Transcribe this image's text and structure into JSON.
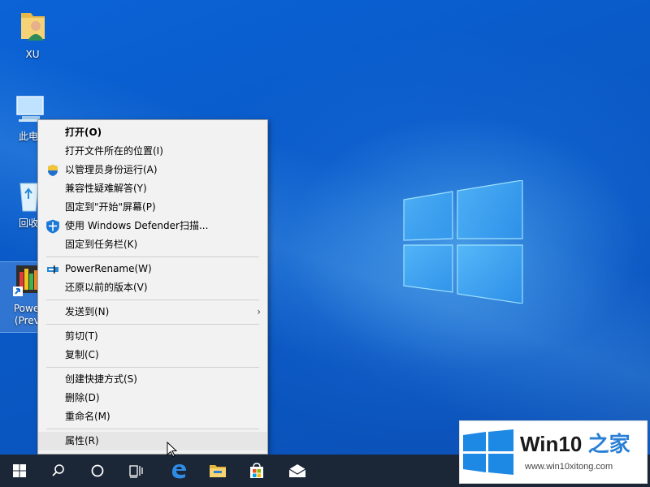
{
  "desktop": {
    "icons": [
      {
        "label": "XU",
        "icon": "user-folder-icon"
      },
      {
        "label": "此电",
        "icon": "this-pc-icon"
      },
      {
        "label": "回收",
        "icon": "recycle-bin-icon"
      },
      {
        "label": "Power",
        "label2": "(Previ",
        "icon": "powertoys-shortcut-icon"
      }
    ]
  },
  "context_menu": {
    "items": [
      {
        "label": "打开(O)",
        "bold": true
      },
      {
        "label": "打开文件所在的位置(I)"
      },
      {
        "label": "以管理员身份运行(A)",
        "icon": "uac-shield-icon"
      },
      {
        "label": "兼容性疑难解答(Y)"
      },
      {
        "label": "固定到\"开始\"屏幕(P)"
      },
      {
        "label": "使用 Windows Defender扫描...",
        "icon": "defender-shield-icon"
      },
      {
        "label": "固定到任务栏(K)"
      },
      {
        "label": "PowerRename(W)",
        "icon": "powerrename-icon"
      },
      {
        "label": "还原以前的版本(V)"
      },
      {
        "label": "发送到(N)",
        "submenu": true
      },
      {
        "label": "剪切(T)"
      },
      {
        "label": "复制(C)"
      },
      {
        "label": "创建快捷方式(S)"
      },
      {
        "label": "删除(D)"
      },
      {
        "label": "重命名(M)"
      },
      {
        "label": "属性(R)",
        "hovered": true
      }
    ]
  },
  "taskbar": {
    "buttons": [
      "start-icon",
      "search-icon",
      "cortana-icon",
      "task-view-icon",
      "edge-icon",
      "file-explorer-icon",
      "store-icon",
      "mail-icon"
    ],
    "color": "#1b2636"
  },
  "watermark": {
    "title_main": "Win10",
    "title_zh": "之家",
    "url": "www.win10xitong.com"
  },
  "colors": {
    "desktop_blue": "#0a5cc8",
    "logo_light": "#7fd0ff",
    "brand_blue": "#2a7fd6"
  }
}
